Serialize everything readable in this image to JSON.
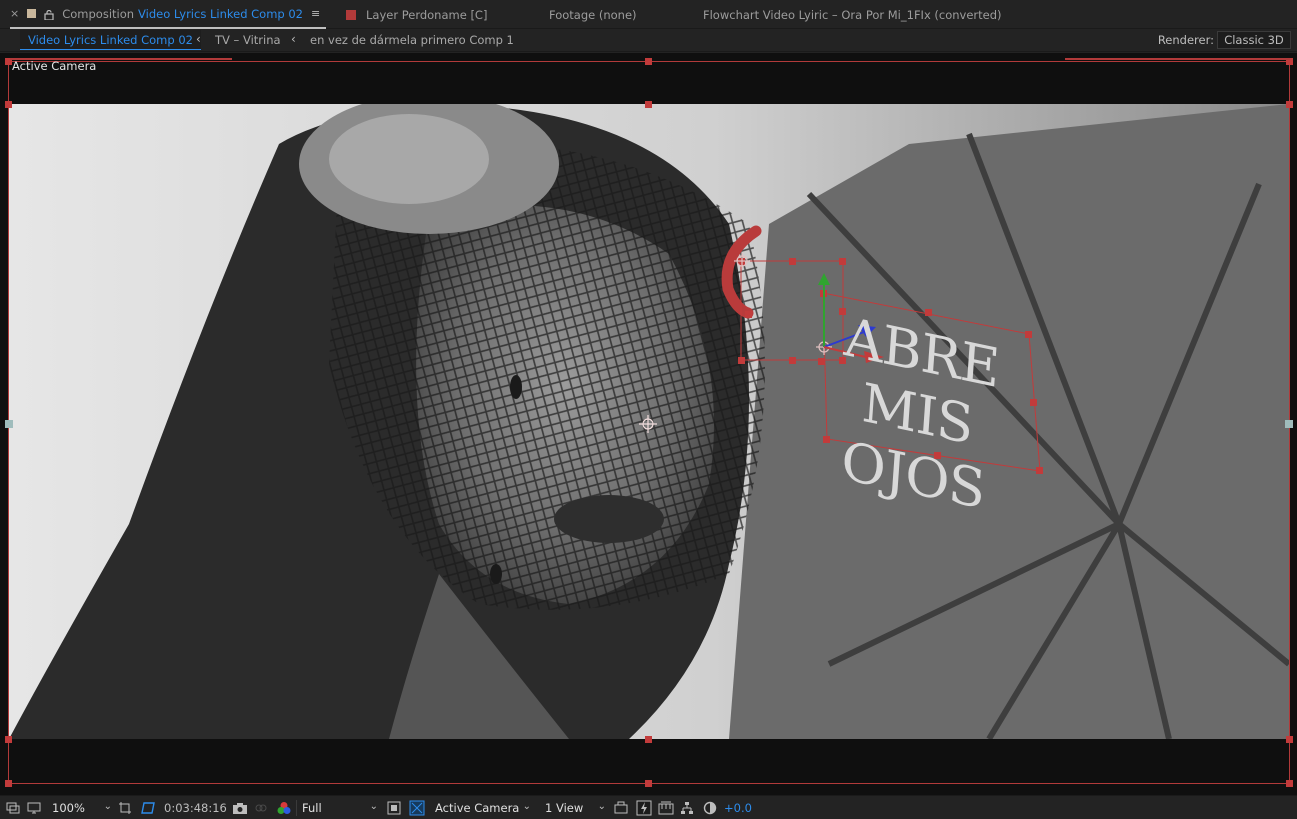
{
  "tabs": {
    "close_glyph": "×",
    "menu_glyph": "≡",
    "composition_prefix": "Composition",
    "composition_name": "Video Lyrics Linked Comp 02",
    "layer": "Layer Perdoname [C]",
    "footage": "Footage (none)",
    "flowchart": "Flowchart Video Lyiric – Ora Por Mi_1FIx (converted)",
    "accent_color": "#2d8ceb",
    "layer_swatch_color": "#b23a3a"
  },
  "breadcrumbs": {
    "items": [
      "Video Lyrics Linked Comp 02",
      "TV – Vitrina",
      "en vez  de  dármela  primero Comp 1"
    ],
    "arrow_glyph": "‹",
    "renderer_label": "Renderer:",
    "renderer_value": "Classic 3D"
  },
  "viewer": {
    "view_label": "Active Camera",
    "lyric_line1": "ABRE MIS",
    "lyric_line2": "OJOS",
    "selection_color": "#c23b3b"
  },
  "toolbar": {
    "zoom": "100%",
    "timecode": "0:03:48:16",
    "resolution": "Full",
    "camera": "Active Camera",
    "views": "1 View",
    "exposure": "+0.0",
    "caret_glyph": "⌄"
  }
}
